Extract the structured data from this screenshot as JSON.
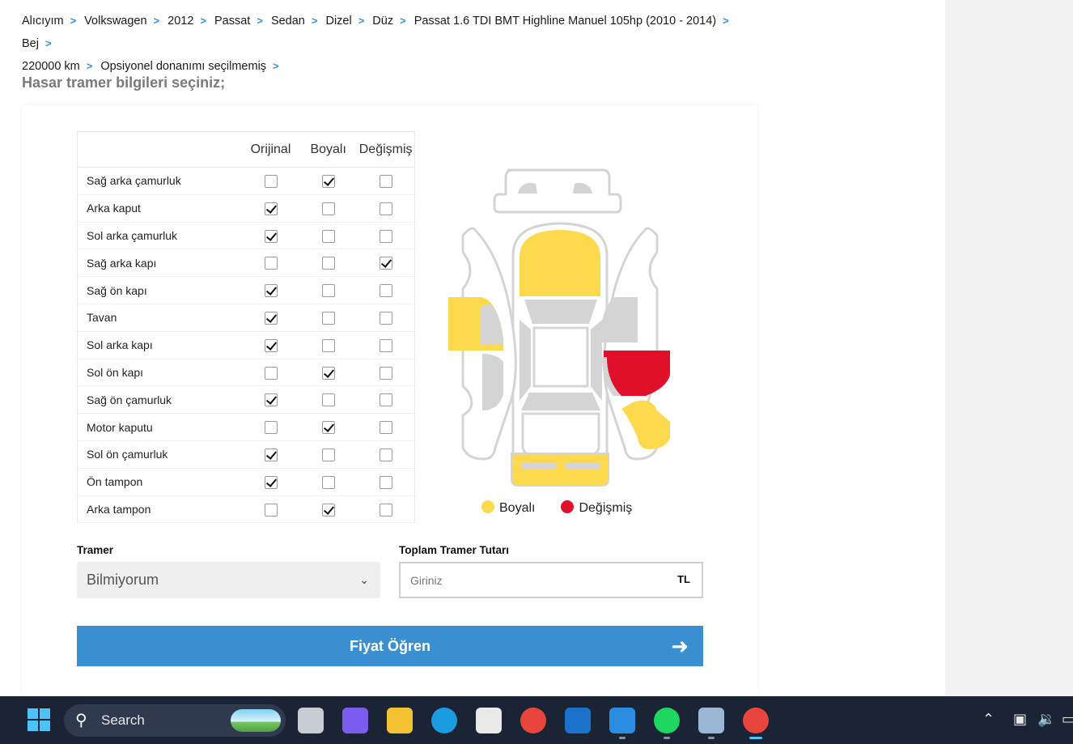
{
  "breadcrumb": [
    "Alıcıyım",
    "Volkswagen",
    "2012",
    "Passat",
    "Sedan",
    "Dizel",
    "Düz",
    "Passat 1.6 TDI BMT Highline Manuel 105hp (2010 - 2014)",
    "Bej",
    "220000 km",
    "Opsiyonel donanımı seçilmemiş"
  ],
  "section_title": "Hasar tramer bilgileri seçiniz;",
  "table": {
    "headers": [
      "Orijinal",
      "Boyalı",
      "Değişmiş"
    ],
    "rows": [
      {
        "part": "Sağ arka çamurluk",
        "state": "Boyalı"
      },
      {
        "part": "Arka kaput",
        "state": "Orijinal"
      },
      {
        "part": "Sol arka çamurluk",
        "state": "Orijinal"
      },
      {
        "part": "Sağ arka kapı",
        "state": "Değişmiş"
      },
      {
        "part": "Sağ ön kapı",
        "state": "Orijinal"
      },
      {
        "part": "Tavan",
        "state": "Orijinal"
      },
      {
        "part": "Sol arka kapı",
        "state": "Orijinal"
      },
      {
        "part": "Sol ön kapı",
        "state": "Boyalı"
      },
      {
        "part": "Sağ ön çamurluk",
        "state": "Orijinal"
      },
      {
        "part": "Motor kaputu",
        "state": "Boyalı"
      },
      {
        "part": "Sol ön çamurluk",
        "state": "Orijinal"
      },
      {
        "part": "Ön tampon",
        "state": "Orijinal"
      },
      {
        "part": "Arka tampon",
        "state": "Boyalı"
      }
    ]
  },
  "legend": {
    "painted": "Boyalı",
    "replaced": "Değişmiş"
  },
  "colors": {
    "painted": "#fdd94e",
    "replaced": "#e0102b",
    "accent": "#3a8fd0",
    "car_part": "#d4d4d4"
  },
  "tramer": {
    "label": "Tramer",
    "value": "Bilmiyorum"
  },
  "total": {
    "label": "Toplam Tramer Tutarı",
    "placeholder": "Giriniz",
    "unit": "TL"
  },
  "cta": {
    "label": "Fiyat Öğren",
    "icon": "arrow-right-icon"
  },
  "taskbar": {
    "search_label": "Search",
    "apps": [
      "task-view-icon",
      "m365-copilot-icon",
      "file-explorer-icon",
      "edge-icon",
      "microsoft-store-icon",
      "chrome-icon",
      "outlook-icon",
      "vscode-icon",
      "spotify-icon",
      "mascot-app-icon",
      "chrome-profile-icon"
    ]
  }
}
